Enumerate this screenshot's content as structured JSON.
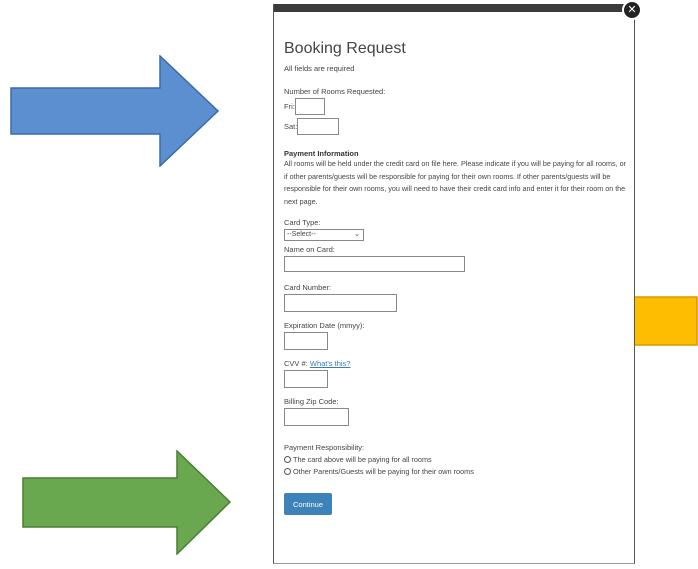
{
  "modal": {
    "title": "Booking Request",
    "required_note": "All fields are required",
    "close_glyph": "✕",
    "rooms": {
      "label": "Number of Rooms Requested:",
      "fri_label": "Fri:",
      "sat_label": "Sat:",
      "fri_value": "",
      "sat_value": ""
    },
    "payment_info": {
      "heading": "Payment Information",
      "text": "All rooms will be held under the credit card on file here. Please indicate if you will be paying for all rooms, or if other parents/guests will be responsible for paying for their own rooms. If other parents/guests will be responsible for their own rooms, you will need to have their credit card info and enter it for their room on the next page."
    },
    "card_type": {
      "label": "Card Type:",
      "selected": "--Select--"
    },
    "name_on_card": {
      "label": "Name on Card:",
      "value": ""
    },
    "card_number": {
      "label": "Card Number:",
      "value": ""
    },
    "expiration": {
      "label": "Expiration Date (mmyy):",
      "value": ""
    },
    "cvv": {
      "label": "CVV #:",
      "link": "What's this?",
      "value": ""
    },
    "billing_zip": {
      "label": "Billing Zip Code:",
      "value": ""
    },
    "payment_responsibility": {
      "label": "Payment Responsibility:",
      "options": [
        "The card above will be paying for all rooms",
        "Other Parents/Guests will be paying for their own rooms"
      ]
    },
    "continue_label": "Continue"
  },
  "arrows": [
    {
      "name": "blue-arrow-right",
      "color": "#5b8fd0",
      "direction": "right"
    },
    {
      "name": "gold-arrow-left",
      "color": "#ffbd00",
      "direction": "left"
    },
    {
      "name": "green-arrow-right",
      "color": "#6aa84f",
      "direction": "right"
    }
  ]
}
